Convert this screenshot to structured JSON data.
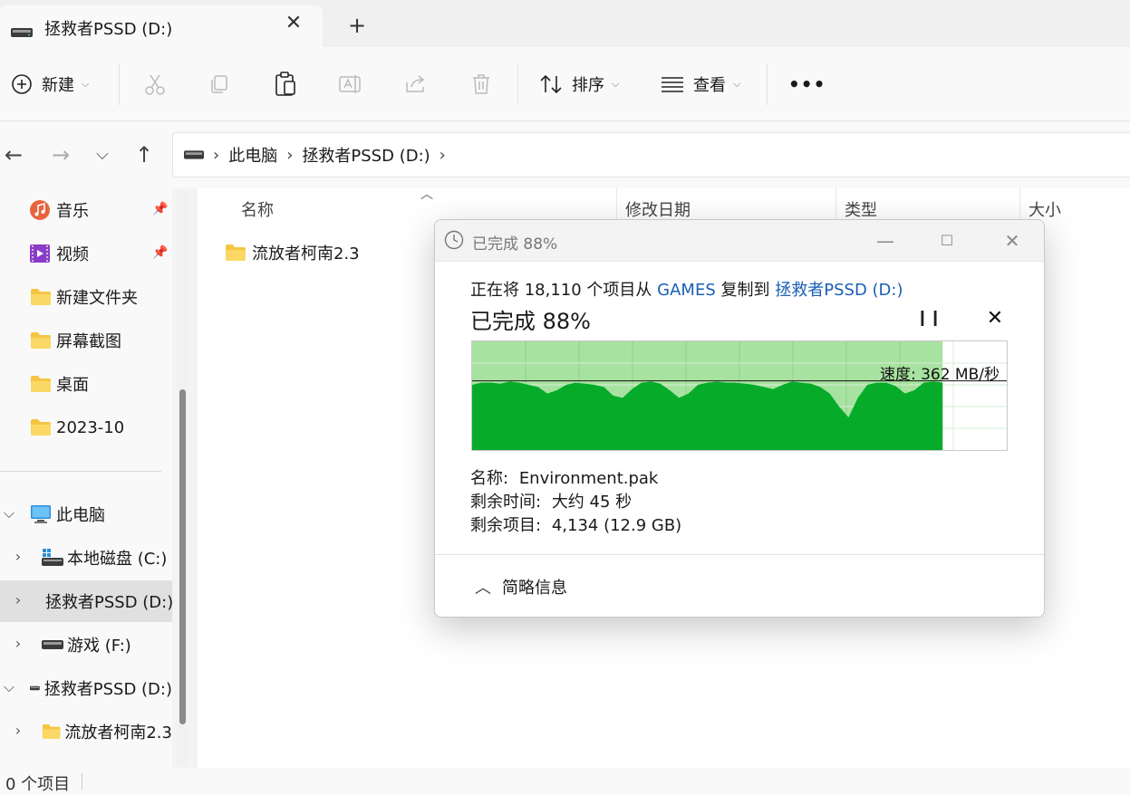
{
  "tab": {
    "title": "拯救者PSSD (D:)",
    "close": "✕",
    "new_tab": "+"
  },
  "toolbar": {
    "new_label": "新建",
    "sort_label": "排序",
    "view_label": "查看",
    "more": "•••"
  },
  "address": {
    "crumbs": [
      "此电脑",
      "拯救者PSSD (D:)"
    ]
  },
  "sidebar": {
    "quick": [
      {
        "label": "音乐",
        "pinned": true
      },
      {
        "label": "视频",
        "pinned": true
      },
      {
        "label": "新建文件夹"
      },
      {
        "label": "屏幕截图"
      },
      {
        "label": "桌面"
      },
      {
        "label": "2023-10"
      }
    ],
    "this_pc": "此电脑",
    "drives": [
      {
        "label": "本地磁盘 (C:)"
      },
      {
        "label": "拯救者PSSD (D:)",
        "selected": true
      },
      {
        "label": "游戏 (F:)"
      }
    ],
    "pssd_root": "拯救者PSSD (D:)",
    "pssd_child": "流放者柯南2.3"
  },
  "content": {
    "columns": [
      "名称",
      "修改日期",
      "类型",
      "大小"
    ],
    "files": [
      {
        "name": "流放者柯南2.3",
        "type": "folder"
      }
    ]
  },
  "status": {
    "items_text": "0 个项目"
  },
  "dialog": {
    "title": "已完成 88%",
    "line_prefix": "正在将 18,110 个项目从",
    "source": "GAMES",
    "line_mid": "复制到",
    "destination": "拯救者PSSD (D:)",
    "headline": "已完成 88%",
    "percent_complete": 88,
    "speed_text": "速度: 362 MB/秒",
    "name_label": "名称:",
    "name_value": "Environment.pak",
    "time_label": "剩余时间:",
    "time_value": "大约 45 秒",
    "items_label": "剩余项目:",
    "items_value": "4,134 (12.9 GB)",
    "less_info": "简略信息",
    "speed_history": [
      60,
      62,
      62,
      61,
      63,
      62,
      60,
      58,
      52,
      55,
      60,
      62,
      61,
      60,
      58,
      50,
      48,
      56,
      62,
      63,
      61,
      55,
      48,
      52,
      60,
      62,
      63,
      62,
      62,
      61,
      60,
      58,
      56,
      60,
      63,
      62,
      61,
      58,
      52,
      40,
      30,
      48,
      60,
      62,
      62,
      59,
      52,
      55,
      62,
      63,
      62
    ]
  },
  "colors": {
    "accent": "#1a5fb4",
    "graph_fill": "#06ab2a",
    "graph_done": "#a8e2a0"
  }
}
